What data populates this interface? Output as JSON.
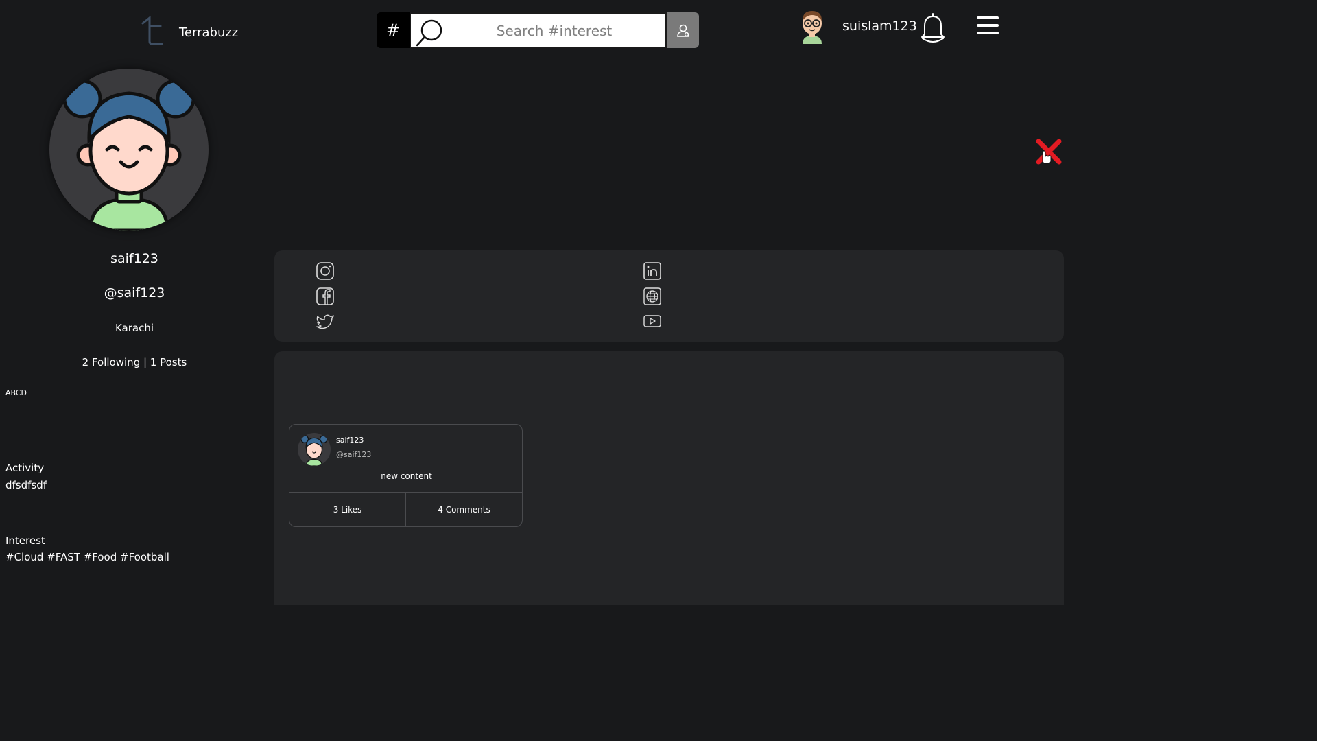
{
  "header": {
    "brand": "Terrabuzz",
    "hash_label": "#",
    "search_placeholder": "Search #interest",
    "username": "suislam123"
  },
  "profile": {
    "name": "saif123",
    "handle": "@saif123",
    "city": "Karachi",
    "stats": "2 Following | 1 Posts",
    "bio": "ABCD",
    "activity_title": "Activity",
    "activity_value": "dfsdfsdf",
    "interest_title": "Interest",
    "interest_value": "#Cloud #FAST #Food #Football"
  },
  "social_icons": [
    "instagram-icon",
    "facebook-icon",
    "twitter-icon",
    "linkedin-icon",
    "globe-icon",
    "youtube-icon"
  ],
  "post": {
    "name": "saif123",
    "handle": "@saif123",
    "content": "new content",
    "likes": "3 Likes",
    "comments": "4 Comments"
  },
  "colors": {
    "background": "#18191b",
    "panel": "#242527",
    "close": "#e31b23"
  }
}
